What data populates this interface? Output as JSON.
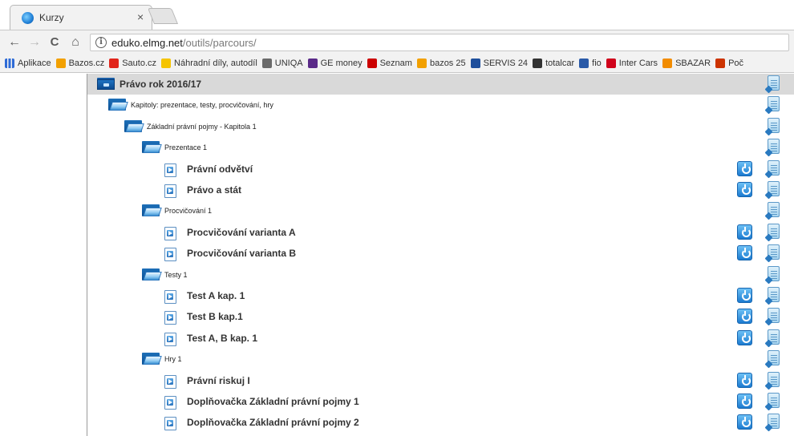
{
  "browser": {
    "tab_title": "Kurzy",
    "tab_close": "×",
    "url_host": "eduko.elmg.net",
    "url_path": "/outils/parcours/",
    "nav": {
      "back": "←",
      "forward": "→",
      "reload": "C",
      "home": "⌂"
    },
    "bookmarks": [
      {
        "label": "Aplikace",
        "icon": "apps-grid-icon",
        "color": "#2e6bd6"
      },
      {
        "label": "Bazos.cz",
        "icon": "bazos-icon",
        "color": "#f2a000"
      },
      {
        "label": "Sauto.cz",
        "icon": "sauto-icon",
        "color": "#e1251b"
      },
      {
        "label": "Náhradní díly, autodíl",
        "icon": "autodily-icon",
        "color": "#f5c400"
      },
      {
        "label": "UNIQA",
        "icon": "uniqa-icon",
        "color": "#6a6a6a"
      },
      {
        "label": "GE money",
        "icon": "ge-money-icon",
        "color": "#5a2a88"
      },
      {
        "label": "Seznam",
        "icon": "seznam-icon",
        "color": "#cc0000"
      },
      {
        "label": "bazos 25",
        "icon": "bazos-icon",
        "color": "#f2a000"
      },
      {
        "label": "SERVIS 24",
        "icon": "servis24-icon",
        "color": "#1e4f9c"
      },
      {
        "label": "totalcar",
        "icon": "totalcar-icon",
        "color": "#333333"
      },
      {
        "label": "fio",
        "icon": "fio-icon",
        "color": "#2a5aa8"
      },
      {
        "label": "Inter Cars",
        "icon": "inter-cars-icon",
        "color": "#d0021b"
      },
      {
        "label": "SBAZAR",
        "icon": "sbazar-icon",
        "color": "#f28c00"
      },
      {
        "label": "Poč",
        "icon": "pocasi-icon",
        "color": "#cc3300"
      }
    ]
  },
  "tree": [
    {
      "level": 0,
      "kind": "book",
      "label": "Právo rok 2016/17",
      "run": false
    },
    {
      "level": 1,
      "kind": "folder",
      "label": "Kapitoly: prezentace, testy, procvičování, hry",
      "run": false
    },
    {
      "level": 2,
      "kind": "folder",
      "label": "Základní právní pojmy - Kapitola 1",
      "run": false
    },
    {
      "level": 3,
      "kind": "folder",
      "label": "Prezentace 1",
      "run": false
    },
    {
      "level": 4,
      "kind": "doc",
      "label": "Právní odvětví",
      "run": true
    },
    {
      "level": 4,
      "kind": "doc",
      "label": "Právo a stát",
      "run": true
    },
    {
      "level": 3,
      "kind": "folder",
      "label": "Procvičování 1",
      "run": false
    },
    {
      "level": 4,
      "kind": "doc",
      "label": "Procvičování varianta A",
      "run": true
    },
    {
      "level": 4,
      "kind": "doc",
      "label": "Procvičování varianta B",
      "run": true
    },
    {
      "level": 3,
      "kind": "folder",
      "label": "Testy 1",
      "run": false
    },
    {
      "level": 4,
      "kind": "doc",
      "label": "Test A kap. 1",
      "run": true
    },
    {
      "level": 4,
      "kind": "doc",
      "label": "Test B kap.1",
      "run": true
    },
    {
      "level": 4,
      "kind": "doc",
      "label": "Test A, B kap. 1",
      "run": true
    },
    {
      "level": 3,
      "kind": "folder",
      "label": "Hry 1",
      "run": false
    },
    {
      "level": 4,
      "kind": "doc",
      "label": "Právní riskuj I",
      "run": true
    },
    {
      "level": 4,
      "kind": "doc",
      "label": "Doplňovačka Základní právní pojmy 1",
      "run": true
    },
    {
      "level": 4,
      "kind": "doc",
      "label": "Doplňovačka Základní právní pojmy 2",
      "run": true
    }
  ]
}
